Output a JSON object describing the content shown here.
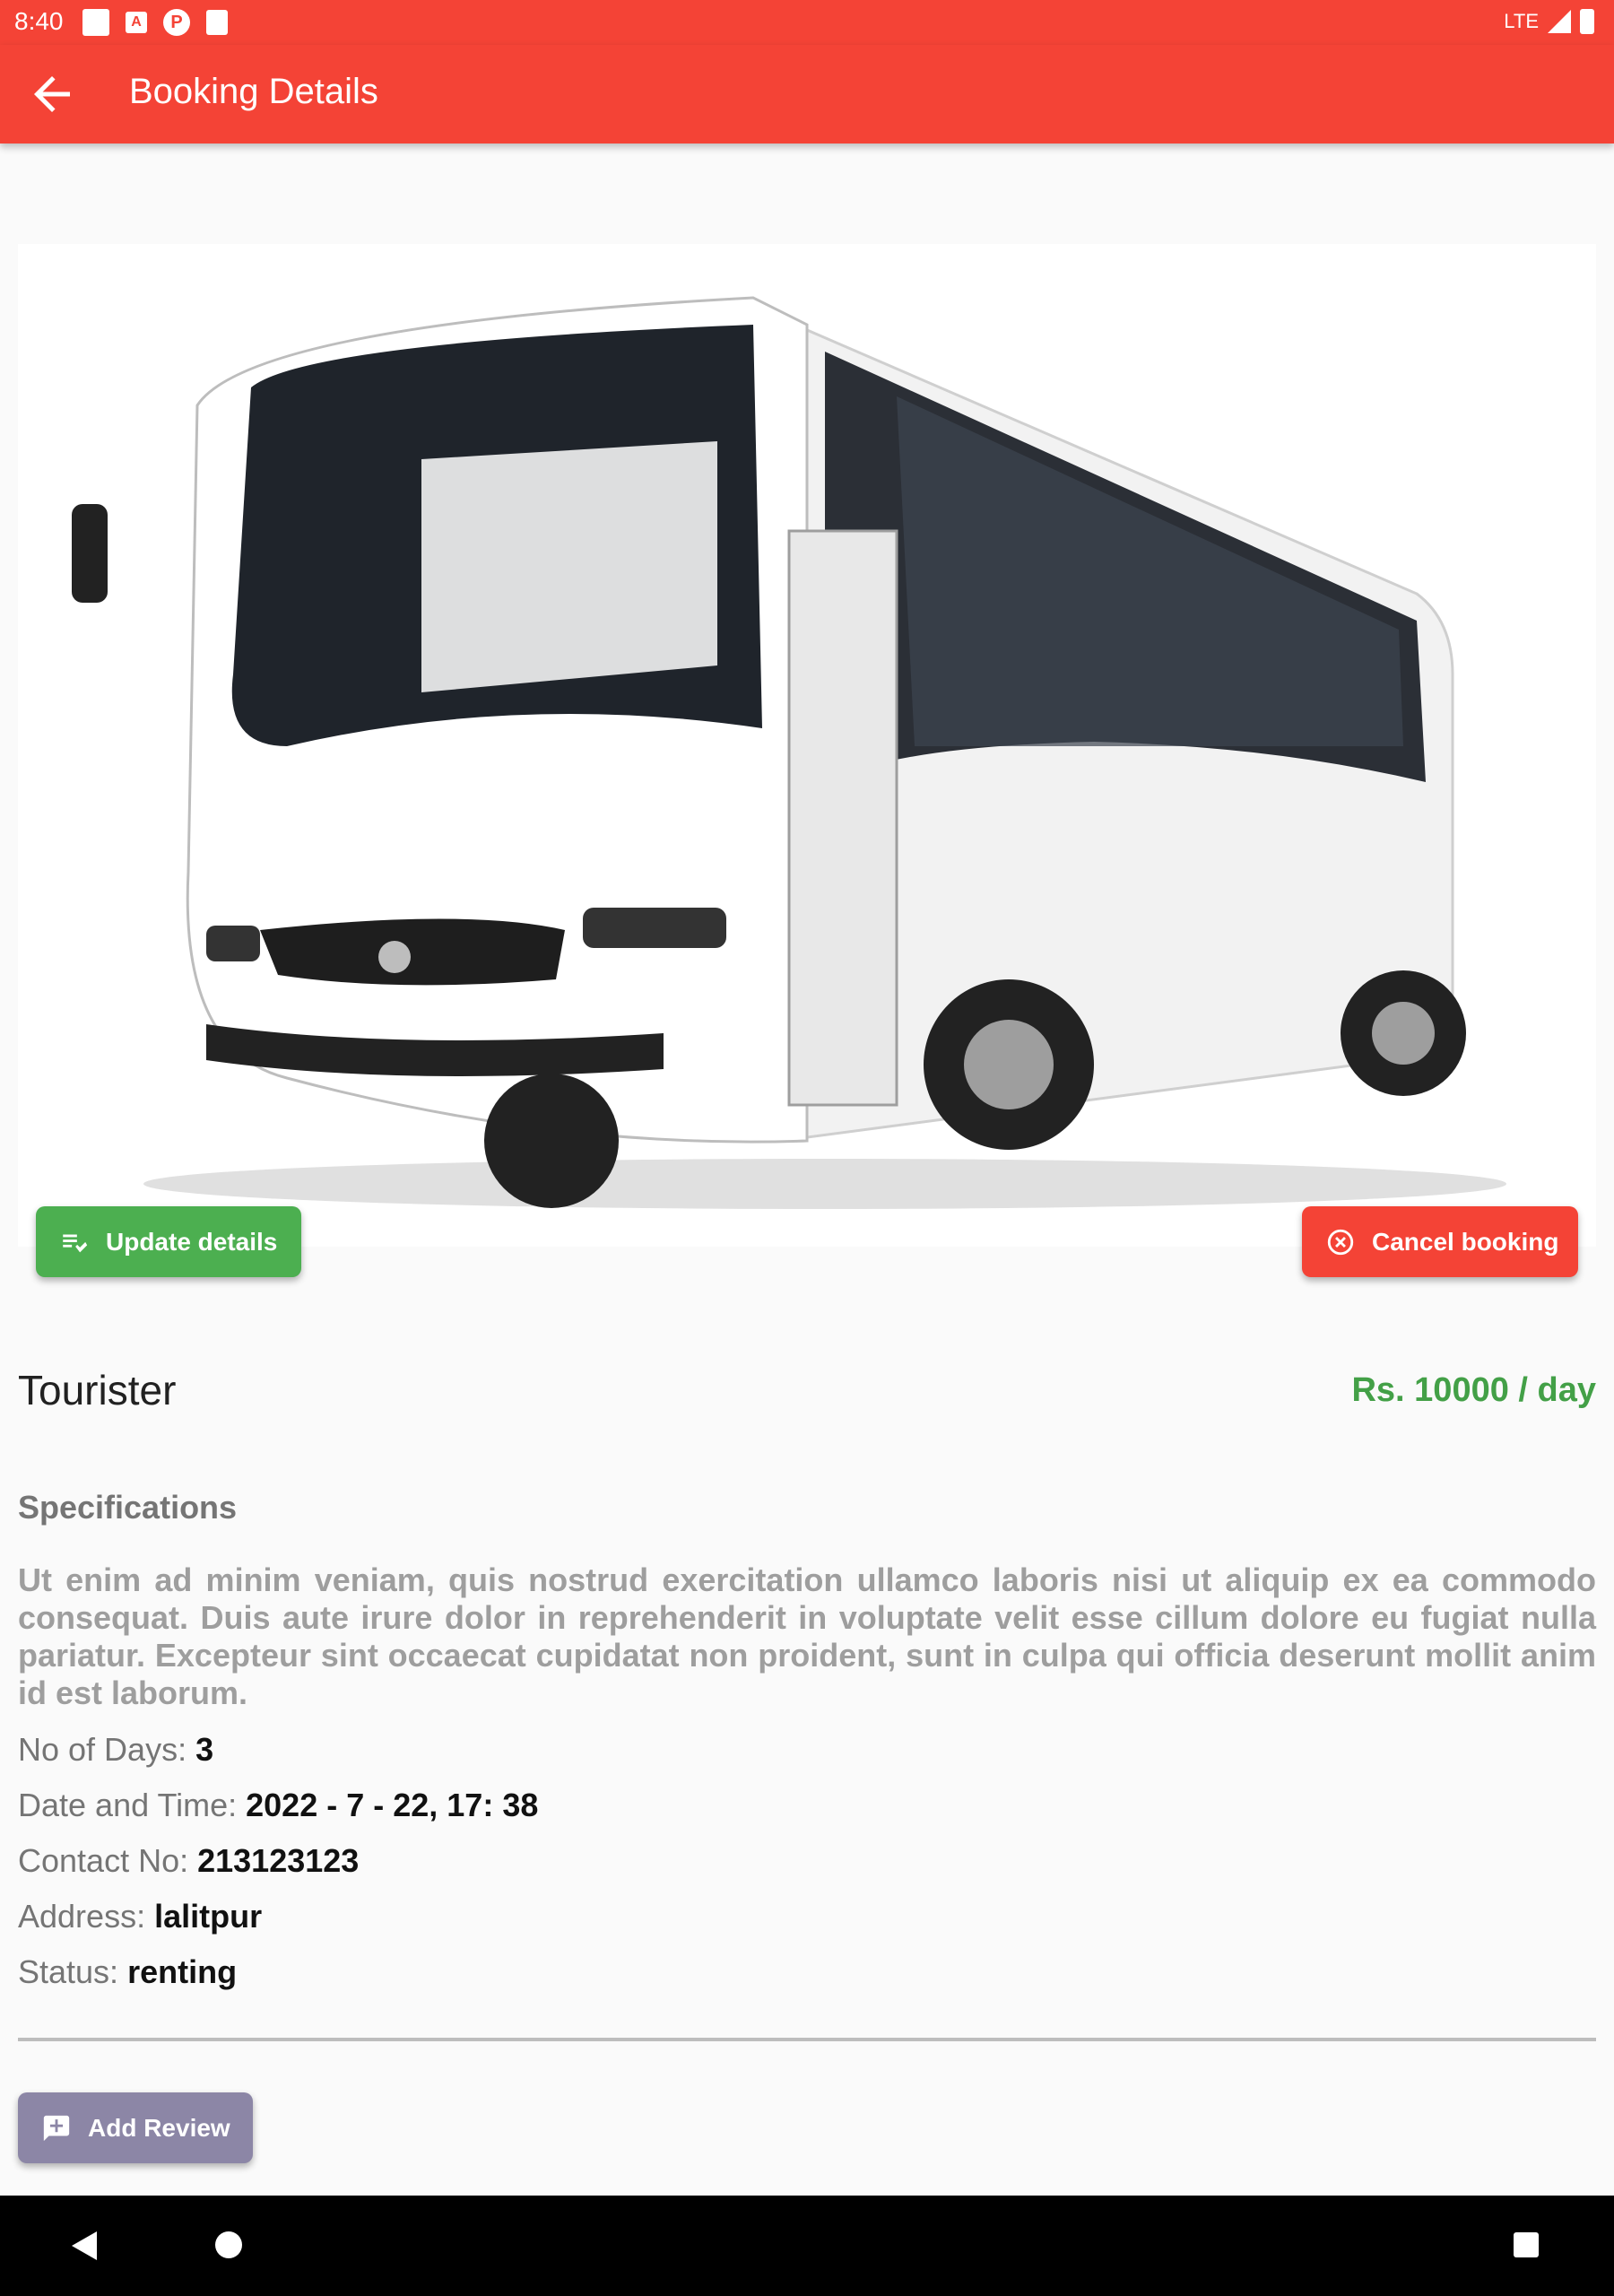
{
  "status_bar": {
    "time": "8:40",
    "network": "LTE"
  },
  "app_bar": {
    "title": "Booking Details",
    "back_icon": "arrow-left-icon"
  },
  "hero": {
    "image_desc_icon": "bus-image"
  },
  "actions": {
    "update_label": "Update details",
    "cancel_label": "Cancel booking",
    "review_label": "Add Review"
  },
  "vehicle": {
    "name": "Tourister",
    "price": "Rs. 10000 / day"
  },
  "specifications": {
    "heading": "Specifications",
    "text": "Ut enim ad minim veniam, quis nostrud exercitation ullamco laboris nisi ut aliquip ex ea commodo consequat.  Duis aute irure dolor in reprehenderit in voluptate velit esse cillum dolore eu fugiat nulla pariatur. Excepteur sint occaecat cupidatat non proident, sunt in culpa qui officia deserunt mollit anim id est laborum."
  },
  "details": [
    {
      "label": "No of Days:",
      "value": "3"
    },
    {
      "label": "Date and Time:",
      "value": "2022 - 7 - 22, 17: 38"
    },
    {
      "label": "Contact No:",
      "value": "213123123"
    },
    {
      "label": "Address:",
      "value": "lalitpur"
    },
    {
      "label": "Status:",
      "value": "renting"
    }
  ],
  "colors": {
    "primary": "#f44336",
    "success": "#4caf50",
    "price": "#43a047",
    "review": "#8c86a6"
  }
}
